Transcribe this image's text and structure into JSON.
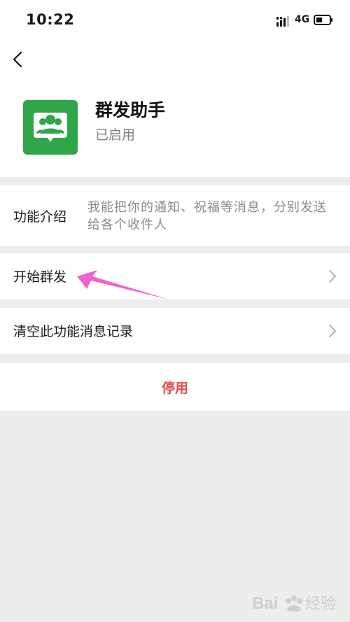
{
  "status_bar": {
    "time": "10:22",
    "network": "4G"
  },
  "nav": {
    "back_icon": "chevron-left-icon"
  },
  "app": {
    "name": "群发助手",
    "status": "已启用",
    "icon_color": "#2fa64a"
  },
  "intro": {
    "label": "功能介绍",
    "description": "我能把你的通知、祝福等消息，分别发送给各个收件人"
  },
  "rows": {
    "start_label": "开始群发",
    "clear_label": "清空此功能消息记录"
  },
  "actions": {
    "disable_label": "停用",
    "disable_color": "#e64a4f"
  },
  "annotation": {
    "arrow_color": "#f062d0"
  },
  "watermark": {
    "text": "Baidu 经验"
  }
}
